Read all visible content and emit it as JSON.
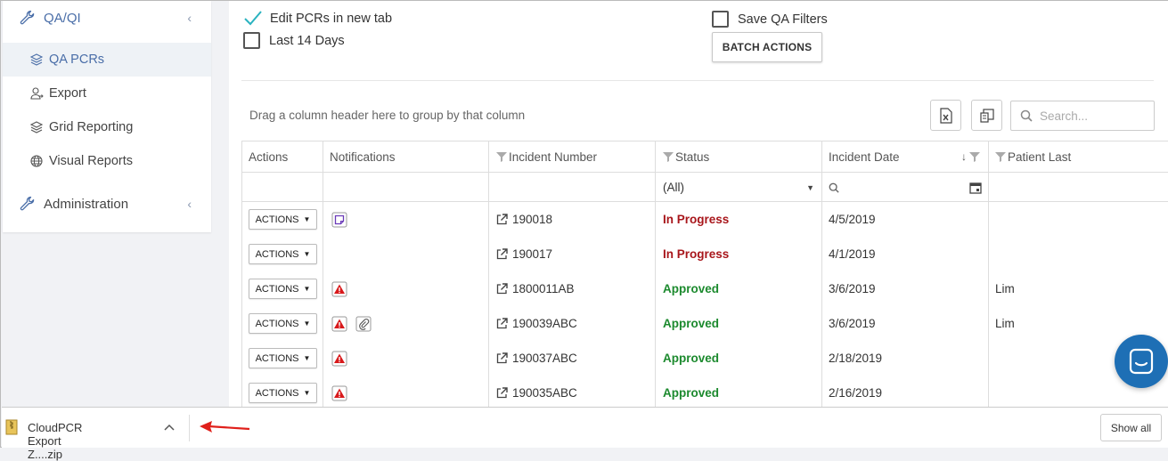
{
  "sidebar": {
    "sections": [
      {
        "label": "QA/QI",
        "icon": "wrench-icon"
      },
      {
        "label": "Administration",
        "icon": "wrench-icon"
      }
    ],
    "items": [
      {
        "label": "QA PCRs",
        "icon": "layers-icon",
        "active": true
      },
      {
        "label": "Export",
        "icon": "user-export-icon"
      },
      {
        "label": "Grid Reporting",
        "icon": "layers-icon"
      },
      {
        "label": "Visual Reports",
        "icon": "globe-icon"
      }
    ]
  },
  "options": {
    "edit_in_new_tab": {
      "label": "Edit PCRs in new tab",
      "checked": true
    },
    "last_14_days": {
      "label": "Last 14 Days",
      "checked": false
    },
    "save_qa_filters": {
      "label": "Save QA Filters",
      "checked": false
    },
    "batch_actions": "BATCH ACTIONS"
  },
  "toolbar": {
    "group_hint": "Drag a column header here to group by that column",
    "search_placeholder": "Search...",
    "excel_icon": "excel-export-icon",
    "chooser_icon": "column-chooser-icon"
  },
  "grid": {
    "columns": [
      "Actions",
      "Notifications",
      "Incident Number",
      "Status",
      "Incident Date",
      "Patient Last"
    ],
    "status_filter": "(All)",
    "action_label": "ACTIONS",
    "rows": [
      {
        "notifications": [
          "note"
        ],
        "incident": "190018",
        "status": "In Progress",
        "date": "4/5/2019",
        "patient": ""
      },
      {
        "notifications": [],
        "incident": "190017",
        "status": "In Progress",
        "date": "4/1/2019",
        "patient": ""
      },
      {
        "notifications": [
          "warning"
        ],
        "incident": "1800011AB",
        "status": "Approved",
        "date": "3/6/2019",
        "patient": "Lim"
      },
      {
        "notifications": [
          "warning",
          "attachment"
        ],
        "incident": "190039ABC",
        "status": "Approved",
        "date": "3/6/2019",
        "patient": "Lim"
      },
      {
        "notifications": [
          "warning"
        ],
        "incident": "190037ABC",
        "status": "Approved",
        "date": "2/18/2019",
        "patient": ""
      },
      {
        "notifications": [
          "warning"
        ],
        "incident": "190035ABC",
        "status": "Approved",
        "date": "2/16/2019",
        "patient": ""
      }
    ]
  },
  "downloads": {
    "file": "CloudPCR Export Z....zip",
    "show_all": "Show all"
  },
  "colors": {
    "in_progress": "#a8161b",
    "approved": "#1c8a2e",
    "accent": "#4a6ea8",
    "chat": "#1e6fb5"
  }
}
